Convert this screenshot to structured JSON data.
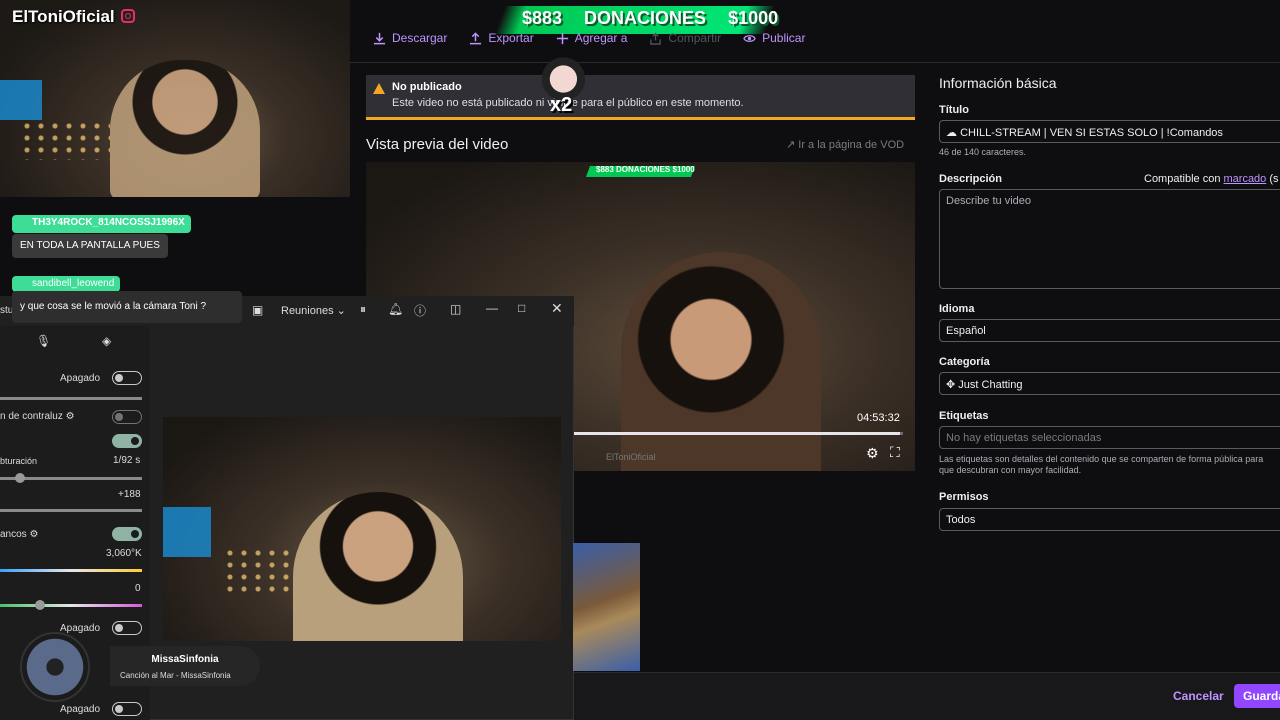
{
  "overlay": {
    "streamer_name": "ElToniOficial",
    "donations": {
      "left": "$883",
      "center": "DONACIONES",
      "right": "$1000"
    },
    "emote_multiplier": "x2"
  },
  "toolbar": {
    "download": "Descargar",
    "export": "Exportar",
    "add_to": "Agregar a",
    "share": "Compartir",
    "publish": "Publicar"
  },
  "warning": {
    "title": "No publicado",
    "description": "Este video no está publicado ni visible para el público en este momento."
  },
  "preview": {
    "title": "Vista previa del video",
    "vod_link": "Ir a la página de VOD",
    "timecode": "04:53:32",
    "progress": 0.99,
    "watermark": "ElToniOficial"
  },
  "info": {
    "section_title": "Información básica",
    "title_label": "Título",
    "title_value": "CHILL-STREAM | VEN SI ESTAS SOLO | !Comandos",
    "char_count": "46 de 140 caracteres.",
    "description_label": "Descripción",
    "description_placeholder": "Describe tu video",
    "markdown_prefix": "Compatible con",
    "markdown_link": "marcado",
    "markdown_suffix": "(s",
    "language_label": "Idioma",
    "language_value": "Español",
    "category_label": "Categoría",
    "category_value": "Just Chatting",
    "tags_label": "Etiquetas",
    "tags_placeholder": "No hay etiquetas seleccionadas",
    "tags_hint": "Las etiquetas son detalles del contenido que se comparten de forma pública para que descubran con mayor facilidad.",
    "permissions_label": "Permisos",
    "permissions_value": "Todos"
  },
  "footer": {
    "cancel": "Cancelar",
    "save": "Guarda"
  },
  "camera_window": {
    "meetings_label": "Reuniones",
    "rows": {
      "apagado_1": "Apagado",
      "backlight": "n de contraluz",
      "shutter": "bturación",
      "shutter_value": "1/92 s",
      "offset_value": "+188",
      "white_balance": "ancos",
      "temp_value": "3,060°K",
      "zero_value": "0",
      "apagado_2": "Apagado",
      "apagado_3": "Apagado"
    },
    "side_label": "stud"
  },
  "chat": {
    "user1": "TH3Y4ROCK_814NCOSSJ1996X",
    "msg1": "EN TODA LA PANTALLA PUES",
    "user2": "sandibell_leowend",
    "msg2": "y que cosa se le movió a la cámara Toni ?"
  },
  "music": {
    "artist": "MissaSinfonia",
    "track": "Canción al Mar - MissaSinfonia"
  },
  "colors": {
    "accent": "#9147ff",
    "link": "#bf94ff",
    "warning": "#f5a623",
    "donation": "#00c853",
    "chat_badge": "#3ddc97"
  }
}
